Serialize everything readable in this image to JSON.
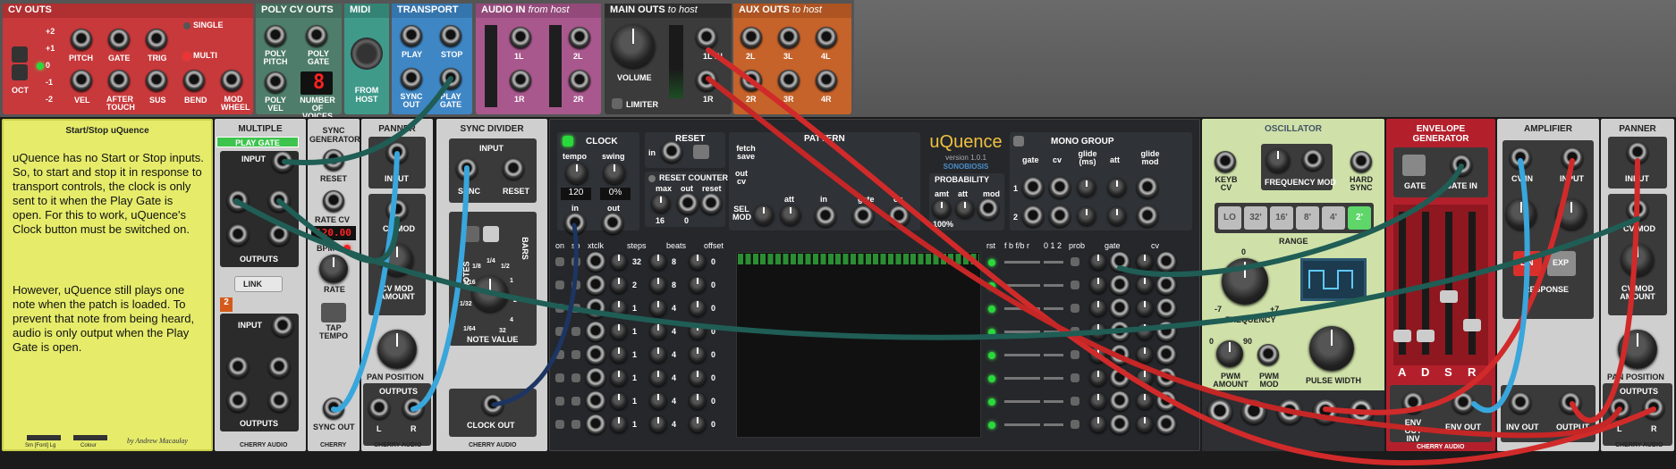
{
  "header": {
    "cv_outs": {
      "title": "CV OUTS",
      "oct": "OCT",
      "oct_values": [
        "+2",
        "+1",
        "0",
        "-1",
        "-2"
      ],
      "labels": [
        "PITCH",
        "GATE",
        "TRIG",
        "VEL",
        "AFTER TOUCH",
        "SUS",
        "BEND",
        "MOD WHEEL"
      ],
      "single": "SINGLE",
      "multi": "MULTI"
    },
    "poly_cv_outs": {
      "title": "POLY CV OUTS",
      "labels": [
        "POLY PITCH",
        "POLY GATE",
        "POLY VEL",
        "NUMBER OF VOICES"
      ],
      "voices": "8"
    },
    "midi": {
      "title": "MIDI",
      "from_host": "FROM HOST"
    },
    "transport": {
      "title": "TRANSPORT",
      "labels": [
        "PLAY",
        "STOP",
        "SYNC OUT",
        "PLAY GATE"
      ]
    },
    "audio_in": {
      "title": "AUDIO IN",
      "subtitle": "from host",
      "labels": [
        "1L",
        "2L",
        "1R",
        "2R"
      ]
    },
    "main_outs": {
      "title": "MAIN OUTS",
      "subtitle": "to host",
      "volume": "VOLUME",
      "limiter": "LIMITER",
      "labels": [
        "1L IN",
        "1R"
      ]
    },
    "aux_outs": {
      "title": "AUX OUTS",
      "subtitle": "to host",
      "labels": [
        "2L",
        "3L",
        "4L",
        "2R",
        "3R",
        "4R"
      ]
    }
  },
  "notes": {
    "title": "Start/Stop uQuence",
    "paragraph1": "uQuence has no Start or Stop inputs.  So, to start and stop it in response to transport controls, the clock is only sent to it when the Play Gate is open.  For this to work, uQuence's Clock button must be switched on.",
    "paragraph2": "However, uQuence still plays one note when the patch is loaded.  To prevent that note from being heard, audio is only output when the Play Gate is open.",
    "size_label": "Sm [Font] Lg",
    "colour_label": "Colour",
    "author": "by Andrew Macaulay"
  },
  "multiple": {
    "title": "MULTIPLE",
    "play_gate_tag": "PLAY GATE",
    "input": "INPUT",
    "outputs": "OUTPUTS",
    "link": "LINK",
    "badge": "2",
    "brand": "CHERRY AUDIO"
  },
  "sync_gen": {
    "title": "SYNC GENERATOR",
    "reset": "RESET",
    "rate_cv": "RATE CV",
    "bpm_value": "120.00",
    "bpm": "BPM",
    "rate": "RATE",
    "tap_tempo": "TAP TEMPO",
    "sync_out": "SYNC OUT",
    "brand": "CHERRY"
  },
  "panner1": {
    "title": "PANNER",
    "input": "INPUT",
    "cv_mod": "CV MOD",
    "cv_mod_amount": "CV MOD AMOUNT",
    "pan_position": "PAN POSITION",
    "outputs": "OUTPUTS",
    "l": "L",
    "r": "R",
    "brand": "CHERRY AUDIO"
  },
  "sync_div": {
    "title": "SYNC DIVIDER",
    "input": "INPUT",
    "sync": "SYNC",
    "reset": "RESET",
    "notes": "NOTES",
    "bars": "BARS",
    "note_value": "NOTE VALUE",
    "clock_out": "CLOCK OUT",
    "brand": "CHERRY AUDIO",
    "ticks": [
      "1/64",
      "1/32",
      "1/16",
      "1/8",
      "1/4",
      "1/2",
      "1",
      "2",
      "4",
      "32"
    ]
  },
  "uquence": {
    "clock": "CLOCK",
    "tempo": "tempo",
    "swing": "swing",
    "tempo_val": "120",
    "swing_val": "0%",
    "in": "in",
    "out": "out",
    "reset": "RESET",
    "reset_in": "in",
    "reset_counter": "RESET COUNTER",
    "max": "max",
    "rc_out": "out",
    "rc_reset": "reset",
    "max_val": "16",
    "out_val": "0",
    "pattern": "PATTERN",
    "fetch_save": "fetch save",
    "out_cv": "out cv",
    "sel_mod": "SEL MOD",
    "att": "att",
    "pat_in": "in",
    "gate": "gate",
    "cv": "cv",
    "name": "uQuence",
    "version": "version 1.0.1",
    "maker": "SONOBIOSIS",
    "probability": "PROBABILITY",
    "amt": "amt",
    "p_att": "att",
    "mod": "mod",
    "pct": "100%",
    "mono_group": "MONO GROUP",
    "mg_labels": [
      "gate",
      "cv",
      "glide (ms)",
      "att",
      "glide mod"
    ],
    "col_heads": [
      "on",
      "so",
      "xtclk",
      "steps",
      "beats",
      "offset"
    ],
    "steps": [
      "32",
      "2",
      "1",
      "1",
      "1",
      "1",
      "1",
      "1"
    ],
    "beats": [
      "8",
      "8",
      "4",
      "4",
      "4",
      "4",
      "4",
      "4"
    ],
    "offsets": [
      "0",
      "0",
      "0",
      "0",
      "0",
      "0",
      "0",
      "0"
    ],
    "row_heads": [
      "rst",
      "f b f/b r",
      "0 1 2",
      "prob",
      "gate",
      "cv"
    ]
  },
  "oscillator": {
    "title": "OSCILLATOR",
    "keyb_cv": "KEYB CV",
    "freq_mod": "FREQUENCY MOD",
    "hard_sync": "HARD SYNC",
    "ranges": [
      "LO",
      "32'",
      "16'",
      "8'",
      "4'",
      "2'"
    ],
    "range": "RANGE",
    "frequency": "FREQUENCY",
    "pwm_amount": "PWM AMOUNT",
    "pwm_mod": "PWM MOD",
    "pulse_width": "PULSE WIDTH",
    "freq_marks": [
      "0",
      "-7",
      "+7"
    ],
    "pw_marks": [
      "0",
      "90"
    ]
  },
  "envelope": {
    "title": "ENVELOPE GENERATOR",
    "gate": "GATE",
    "gate_in": "GATE IN",
    "adsr": [
      "A",
      "D",
      "S",
      "R"
    ],
    "env_out_inv": "ENV OUT INV",
    "env_out": "ENV OUT",
    "brand": "CHERRY AUDIO"
  },
  "amplifier": {
    "title": "AMPLIFIER",
    "cv_in": "CV IN",
    "input": "INPUT",
    "response": "RESPONSE",
    "lin": "LIN",
    "exp": "EXP",
    "inv_out": "INV OUT",
    "output": "OUTPUT"
  },
  "panner2": {
    "title": "PANNER",
    "input": "INPUT",
    "cv_mod": "CV MOD",
    "cv_mod_amount": "CV MOD AMOUNT",
    "pan_position": "PAN POSITION",
    "outputs": "OUTPUTS",
    "l": "L",
    "r": "R",
    "brand": "CHERRY AUDIO"
  },
  "colors": {
    "cv_outs": "#c8393b",
    "poly": "#4f7d6b",
    "midi": "#3f9a8a",
    "transport": "#3f86c4",
    "audio_in": "#a9588e",
    "main_outs": "#3b3b3b",
    "aux_outs": "#c5632b",
    "cable_green": "#1f5d55",
    "cable_blue": "#39a6dc",
    "cable_red": "#d12a2a",
    "cable_navy": "#1d3562"
  }
}
